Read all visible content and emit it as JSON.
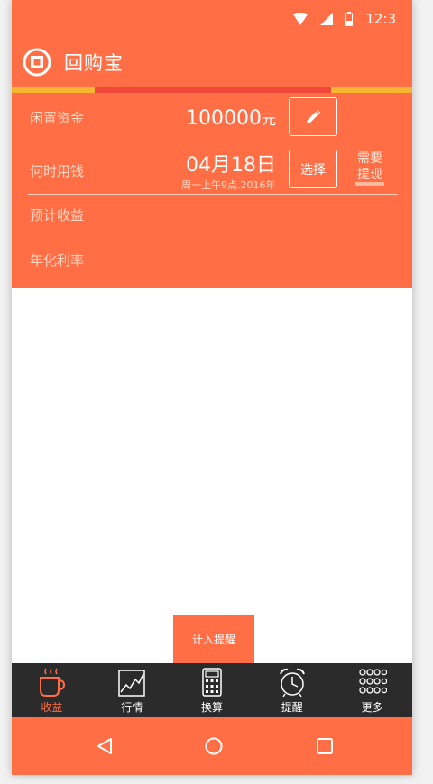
{
  "status": {
    "time": "12:3"
  },
  "app": {
    "title": "回购宝"
  },
  "form": {
    "idle_funds_label": "闲置资金",
    "idle_funds_value": "100000",
    "idle_funds_unit": "元",
    "when_label": "何时用钱",
    "date_value": "04月18日",
    "date_sub": "周一上午9点.2016年",
    "select_button": "选择",
    "need_withdraw_line1": "需要",
    "need_withdraw_line2": "提现",
    "expected_income_label": "预计收益",
    "annual_rate_label": "年化利率"
  },
  "actions": {
    "remind_button": "计入提醒"
  },
  "tabs": [
    {
      "label": "收益",
      "icon": "coffee-cup-icon",
      "active": true
    },
    {
      "label": "行情",
      "icon": "line-chart-icon",
      "active": false
    },
    {
      "label": "换算",
      "icon": "calculator-icon",
      "active": false
    },
    {
      "label": "提醒",
      "icon": "alarm-clock-icon",
      "active": false
    },
    {
      "label": "更多",
      "icon": "grid-dots-icon",
      "active": false
    }
  ],
  "colors": {
    "primary": "#ff6e44",
    "tabbar_bg": "#2b2b2b",
    "stripe_yellow": "#f5b731",
    "stripe_red": "#f2483a"
  }
}
